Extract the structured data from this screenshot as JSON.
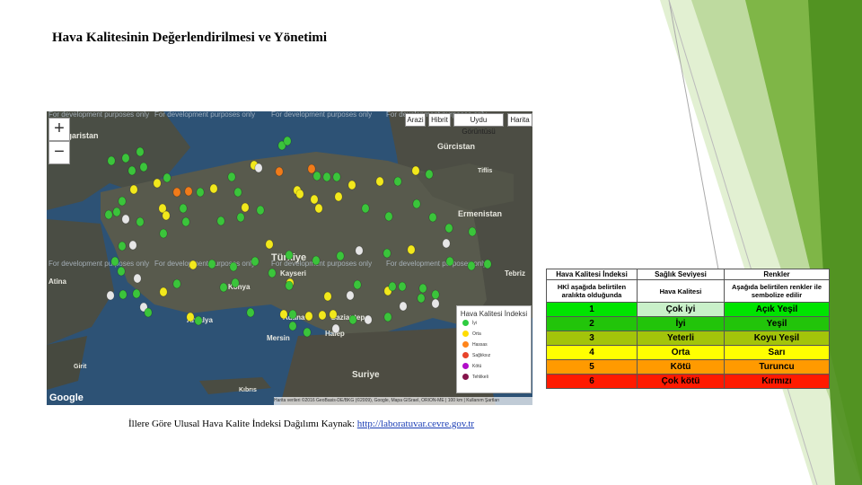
{
  "slide": {
    "title": "Hava Kalitesinin Değerlendirilmesi ve Yönetimi",
    "caption_text": "İllere Göre Ulusal Hava Kalite İndeksi Dağılımı Kaynak: ",
    "caption_link": "http://laboratuvar.cevre.gov.tr"
  },
  "map": {
    "zoom_in": "+",
    "zoom_out": "−",
    "map_types": [
      "Arazi",
      "Hibrit",
      "Uydu Görüntüsü",
      "Harita"
    ],
    "watermark": "For development purposes only",
    "google_logo": "Google",
    "attribution": "Harita verileri ©2016 GeoBasis-DE/BKG (©2009), Google, Mapa GISrael, ORION-ME | 100 km | Kullanım Şartları",
    "labels": [
      "Bulgaristan",
      "Gürcistan",
      "Tiflis",
      "Ermenistan",
      "Türkiye",
      "Kayseri",
      "Konya",
      "Antalya",
      "Mersin",
      "Adana",
      "Gaziantep",
      "Halep",
      "Suriye",
      "Tebriz",
      "Atina",
      "Kıbrıs",
      "Girit"
    ],
    "legend": {
      "title": "Hava Kalitesi İndeksi",
      "items": [
        {
          "label": "İyi",
          "color": "#2ecc40"
        },
        {
          "label": "Orta",
          "color": "#ffdc00"
        },
        {
          "label": "Hassas",
          "color": "#ff851b"
        },
        {
          "label": "Sağlıksız",
          "color": "#e8432a"
        },
        {
          "label": "Kötü",
          "color": "#b10dc9"
        },
        {
          "label": "Tehlikeli",
          "color": "#85144b"
        }
      ]
    },
    "colors": {
      "green": "#3bc43b",
      "yellow": "#f2e81c",
      "orange": "#f07b1a",
      "white": "#e6e6e6"
    }
  },
  "aqi_table": {
    "headers": [
      "Hava Kalitesi İndeksi",
      "Sağlık Seviyesi",
      "Renkler"
    ],
    "subheaders": [
      "HKİ aşağıda belirtilen aralıkta olduğunda",
      "Hava Kalitesi",
      "Aşağıda belirtilen renkler ile sembolize edilir"
    ],
    "rows": [
      {
        "index": "1",
        "level": "Çok iyi",
        "color_name": "Açık Yeşil",
        "bg": "#00e400"
      },
      {
        "index": "2",
        "level": "İyi",
        "color_name": "Yeşil",
        "bg": "#22c40a"
      },
      {
        "index": "3",
        "level": "Yeterli",
        "color_name": "Koyu Yeşil",
        "bg": "#a3c40a"
      },
      {
        "index": "4",
        "level": "Orta",
        "color_name": "Sarı",
        "bg": "#ffff00"
      },
      {
        "index": "5",
        "level": "Kötü",
        "color_name": "Turuncu",
        "bg": "#ff9a00"
      },
      {
        "index": "6",
        "level": "Çok kötü",
        "color_name": "Kırmızı",
        "bg": "#ff1a00"
      }
    ],
    "colors": {
      "header_bg": "#ffffff",
      "first_row_level_bg": "#c9f0c9"
    }
  }
}
